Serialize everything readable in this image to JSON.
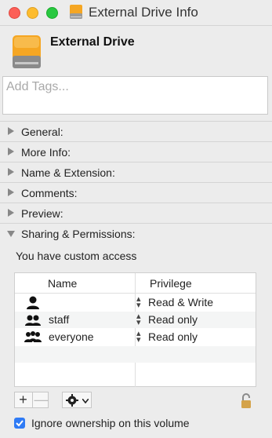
{
  "window": {
    "title": "External Drive Info"
  },
  "header": {
    "name": "External Drive"
  },
  "tags": {
    "placeholder": "Add Tags..."
  },
  "sections": [
    {
      "label": "General:",
      "expanded": false
    },
    {
      "label": "More Info:",
      "expanded": false
    },
    {
      "label": "Name & Extension:",
      "expanded": false
    },
    {
      "label": "Comments:",
      "expanded": false
    },
    {
      "label": "Preview:",
      "expanded": false
    },
    {
      "label": "Sharing & Permissions:",
      "expanded": true
    }
  ],
  "sharing": {
    "access_text": "You have custom access",
    "columns": {
      "name": "Name",
      "privilege": "Privilege"
    },
    "rows": [
      {
        "name": "",
        "privilege": "Read & Write",
        "icon": "user-icon"
      },
      {
        "name": "staff",
        "privilege": "Read only",
        "icon": "group-icon"
      },
      {
        "name": "everyone",
        "privilege": "Read only",
        "icon": "everyone-icon"
      }
    ],
    "add_label": "+",
    "remove_label": "—"
  },
  "ownership": {
    "label": "Ignore ownership on this volume",
    "checked": true
  },
  "colors": {
    "accent": "#2f7bf5",
    "drive": "#f5a623"
  }
}
